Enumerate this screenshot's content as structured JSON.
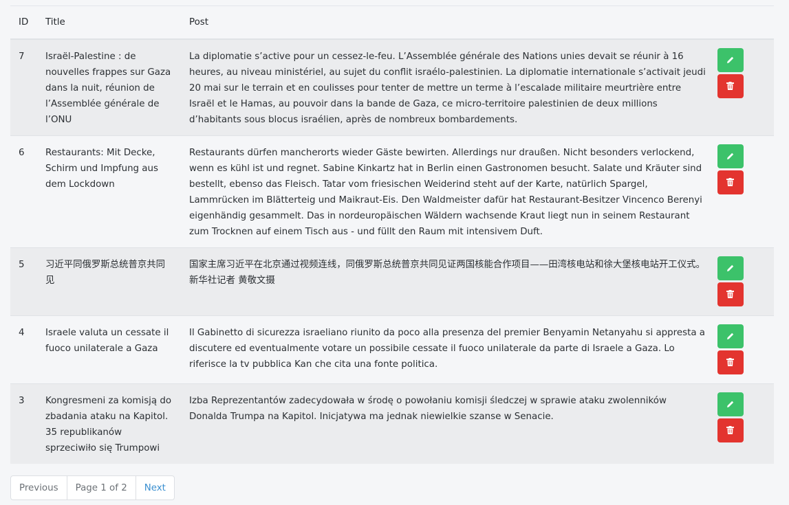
{
  "table": {
    "headers": {
      "id": "ID",
      "title": "Title",
      "post": "Post"
    },
    "rows": [
      {
        "id": "7",
        "title": "Israël-Palestine : de nouvelles frappes sur Gaza dans la nuit, réunion de l’Assemblée générale de l’ONU",
        "post": "La diplomatie s’active pour un cessez-le-feu. L’Assemblée générale des Nations unies devait se réunir à 16 heures, au niveau ministériel, au sujet du conflit israélo-palestinien. La diplomatie internationale s’activait jeudi 20 mai sur le terrain et en coulisses pour tenter de mettre un terme à l’escalade militaire meurtrière entre Israël et le Hamas, au pouvoir dans la bande de Gaza, ce micro-territoire palestinien de deux millions d’habitants sous blocus israélien, après de nombreux bombardements."
      },
      {
        "id": "6",
        "title": "Restaurants: Mit Decke, Schirm und Impfung aus dem Lockdown",
        "post": "Restaurants dürfen mancherorts wieder Gäste bewirten. Allerdings nur draußen. Nicht besonders verlockend, wenn es kühl ist und regnet. Sabine Kinkartz hat in Berlin einen Gastronomen besucht. Salate und Kräuter sind bestellt, ebenso das Fleisch. Tatar vom friesischen Weiderind steht auf der Karte, natürlich Spargel, Lammrücken im Blätterteig und Maikraut-Eis. Den Waldmeister dafür hat Restaurant-Besitzer Vincenco Berenyi eigenhändig gesammelt. Das in nordeuropäischen Wäldern wachsende Kraut liegt nun in seinem Restaurant zum Trocknen auf einem Tisch aus - und füllt den Raum mit intensivem Duft."
      },
      {
        "id": "5",
        "title": "习近平同俄罗斯总统普京共同见",
        "post": "国家主席习近平在北京通过视频连线，同俄罗斯总统普京共同见证两国核能合作项目——田湾核电站和徐大堡核电站开工仪式。　　新华社记者 黄敬文摄"
      },
      {
        "id": "4",
        "title": "Israele valuta un cessate il fuoco unilaterale a Gaza",
        "post": "Il Gabinetto di sicurezza israeliano riunito da poco alla presenza del premier Benyamin Netanyahu si appresta a discutere ed eventualmente votare un possibile cessate il fuoco unilaterale da parte di Israele a Gaza. Lo riferisce la tv pubblica Kan che cita una fonte politica."
      },
      {
        "id": "3",
        "title": "Kongresmeni za komisją do zbadania ataku na Kapitol. 35 republikanów sprzeciwiło się Trumpowi",
        "post": "Izba Reprezentantów zadecydowała w środę o powołaniu komisji śledczej w sprawie ataku zwolenników Donalda Trumpa na Kapitol. Inicjatywa ma jednak niewielkie szanse w Senacie."
      }
    ]
  },
  "pagination": {
    "previous": "Previous",
    "page_info": "Page 1 of 2",
    "next": "Next"
  },
  "colors": {
    "edit_button": "#3cc26a",
    "delete_button": "#e3342f",
    "link": "#3a8fd0"
  },
  "icons": {
    "edit": "pencil-icon",
    "delete": "trash-icon"
  }
}
